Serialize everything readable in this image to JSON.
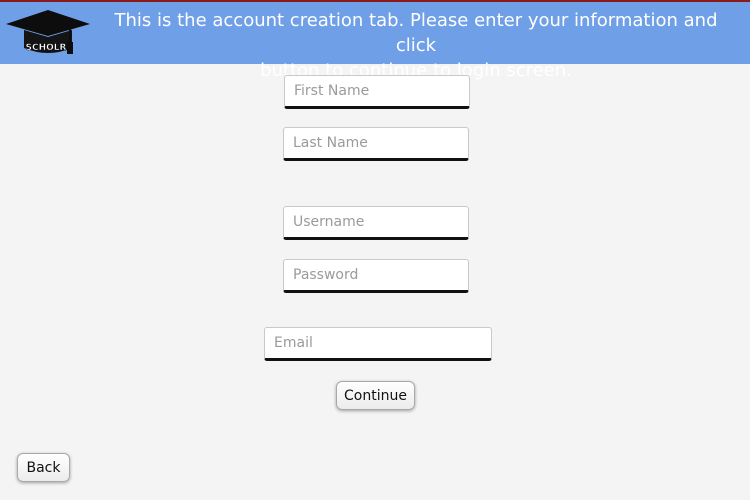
{
  "header": {
    "message": "This is the account creation tab. Please enter your information and click\nbutton to continue to login screen.",
    "logo_text": "SCHOLR",
    "background_color": "#6f9fe6"
  },
  "form": {
    "first_name": {
      "placeholder": "First Name",
      "value": ""
    },
    "last_name": {
      "placeholder": "Last Name",
      "value": ""
    },
    "username": {
      "placeholder": "Username",
      "value": ""
    },
    "password": {
      "placeholder": "Password",
      "value": ""
    },
    "email": {
      "placeholder": "Email",
      "value": ""
    }
  },
  "buttons": {
    "continue_label": "Continue",
    "back_label": "Back"
  }
}
